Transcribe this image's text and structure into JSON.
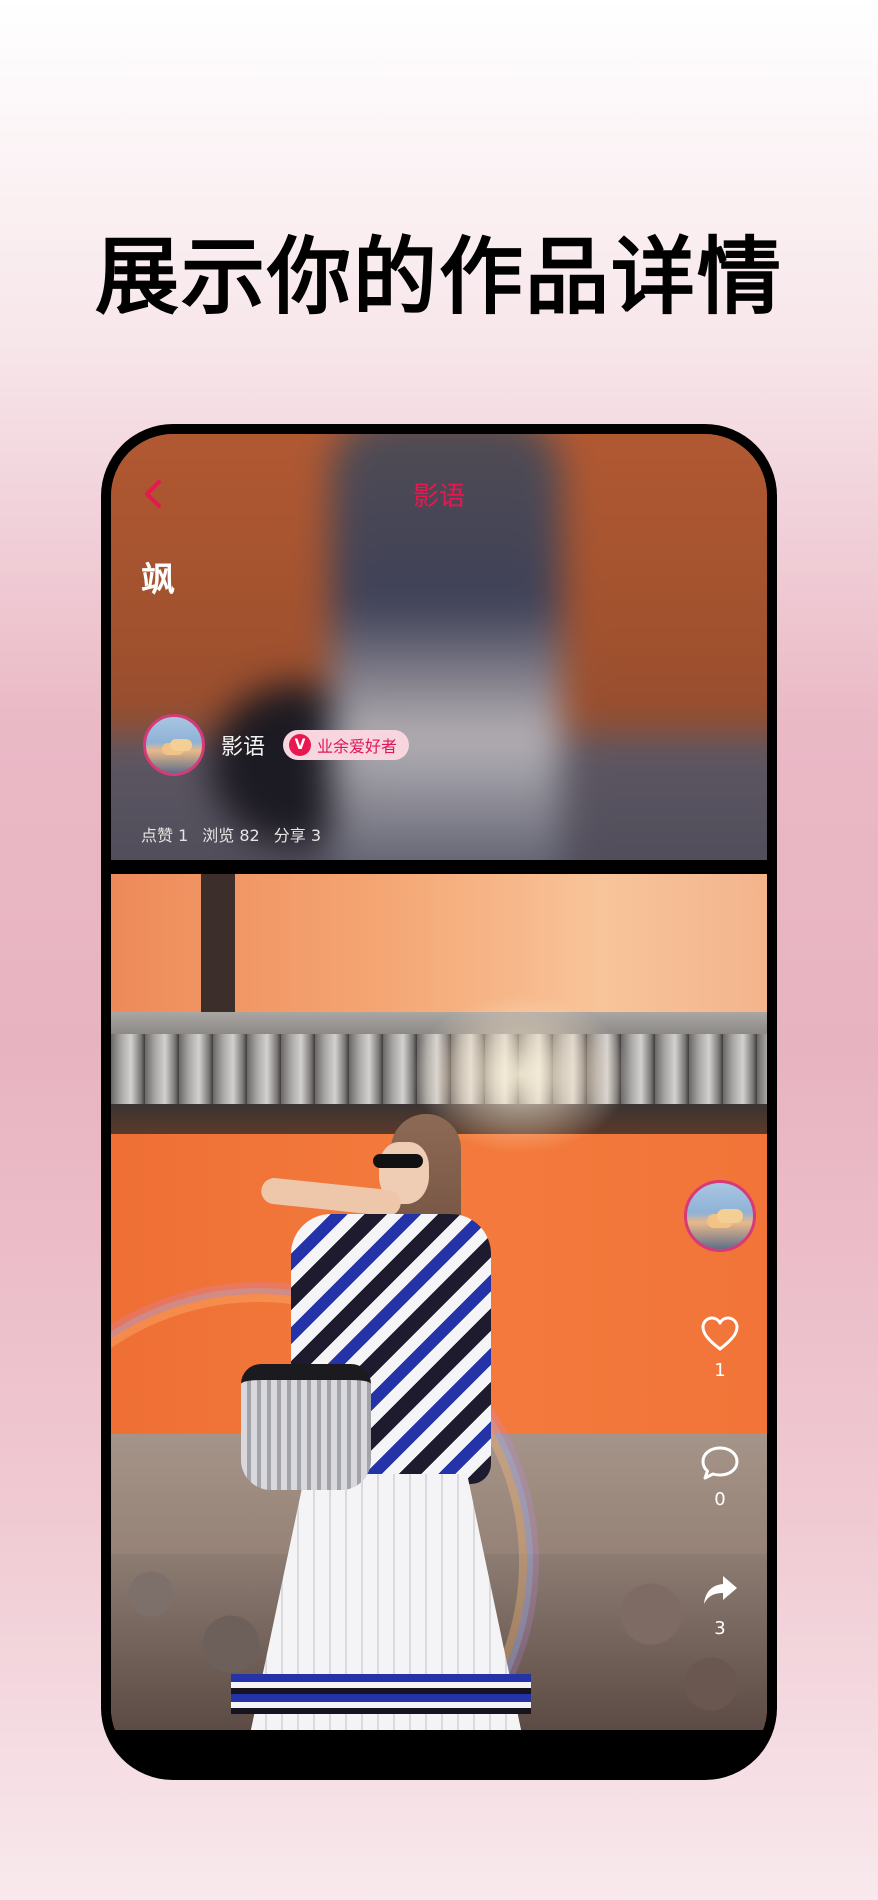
{
  "headline": "展示你的作品详情",
  "nav": {
    "title": "影语"
  },
  "work": {
    "title": "飒"
  },
  "author": {
    "name": "影语",
    "badge_letter": "V",
    "badge_label": "业余爱好者"
  },
  "stats": {
    "likes": "点赞 1",
    "views": "浏览 82",
    "shares": "分享 3"
  },
  "actions": {
    "like_count": "1",
    "comment_count": "0",
    "share_count": "3"
  },
  "colors": {
    "accent": "#e8174f",
    "badge_bg": "#f7d6df"
  },
  "icons": [
    "back-chevron-icon",
    "heart-icon",
    "comment-icon",
    "share-icon"
  ]
}
